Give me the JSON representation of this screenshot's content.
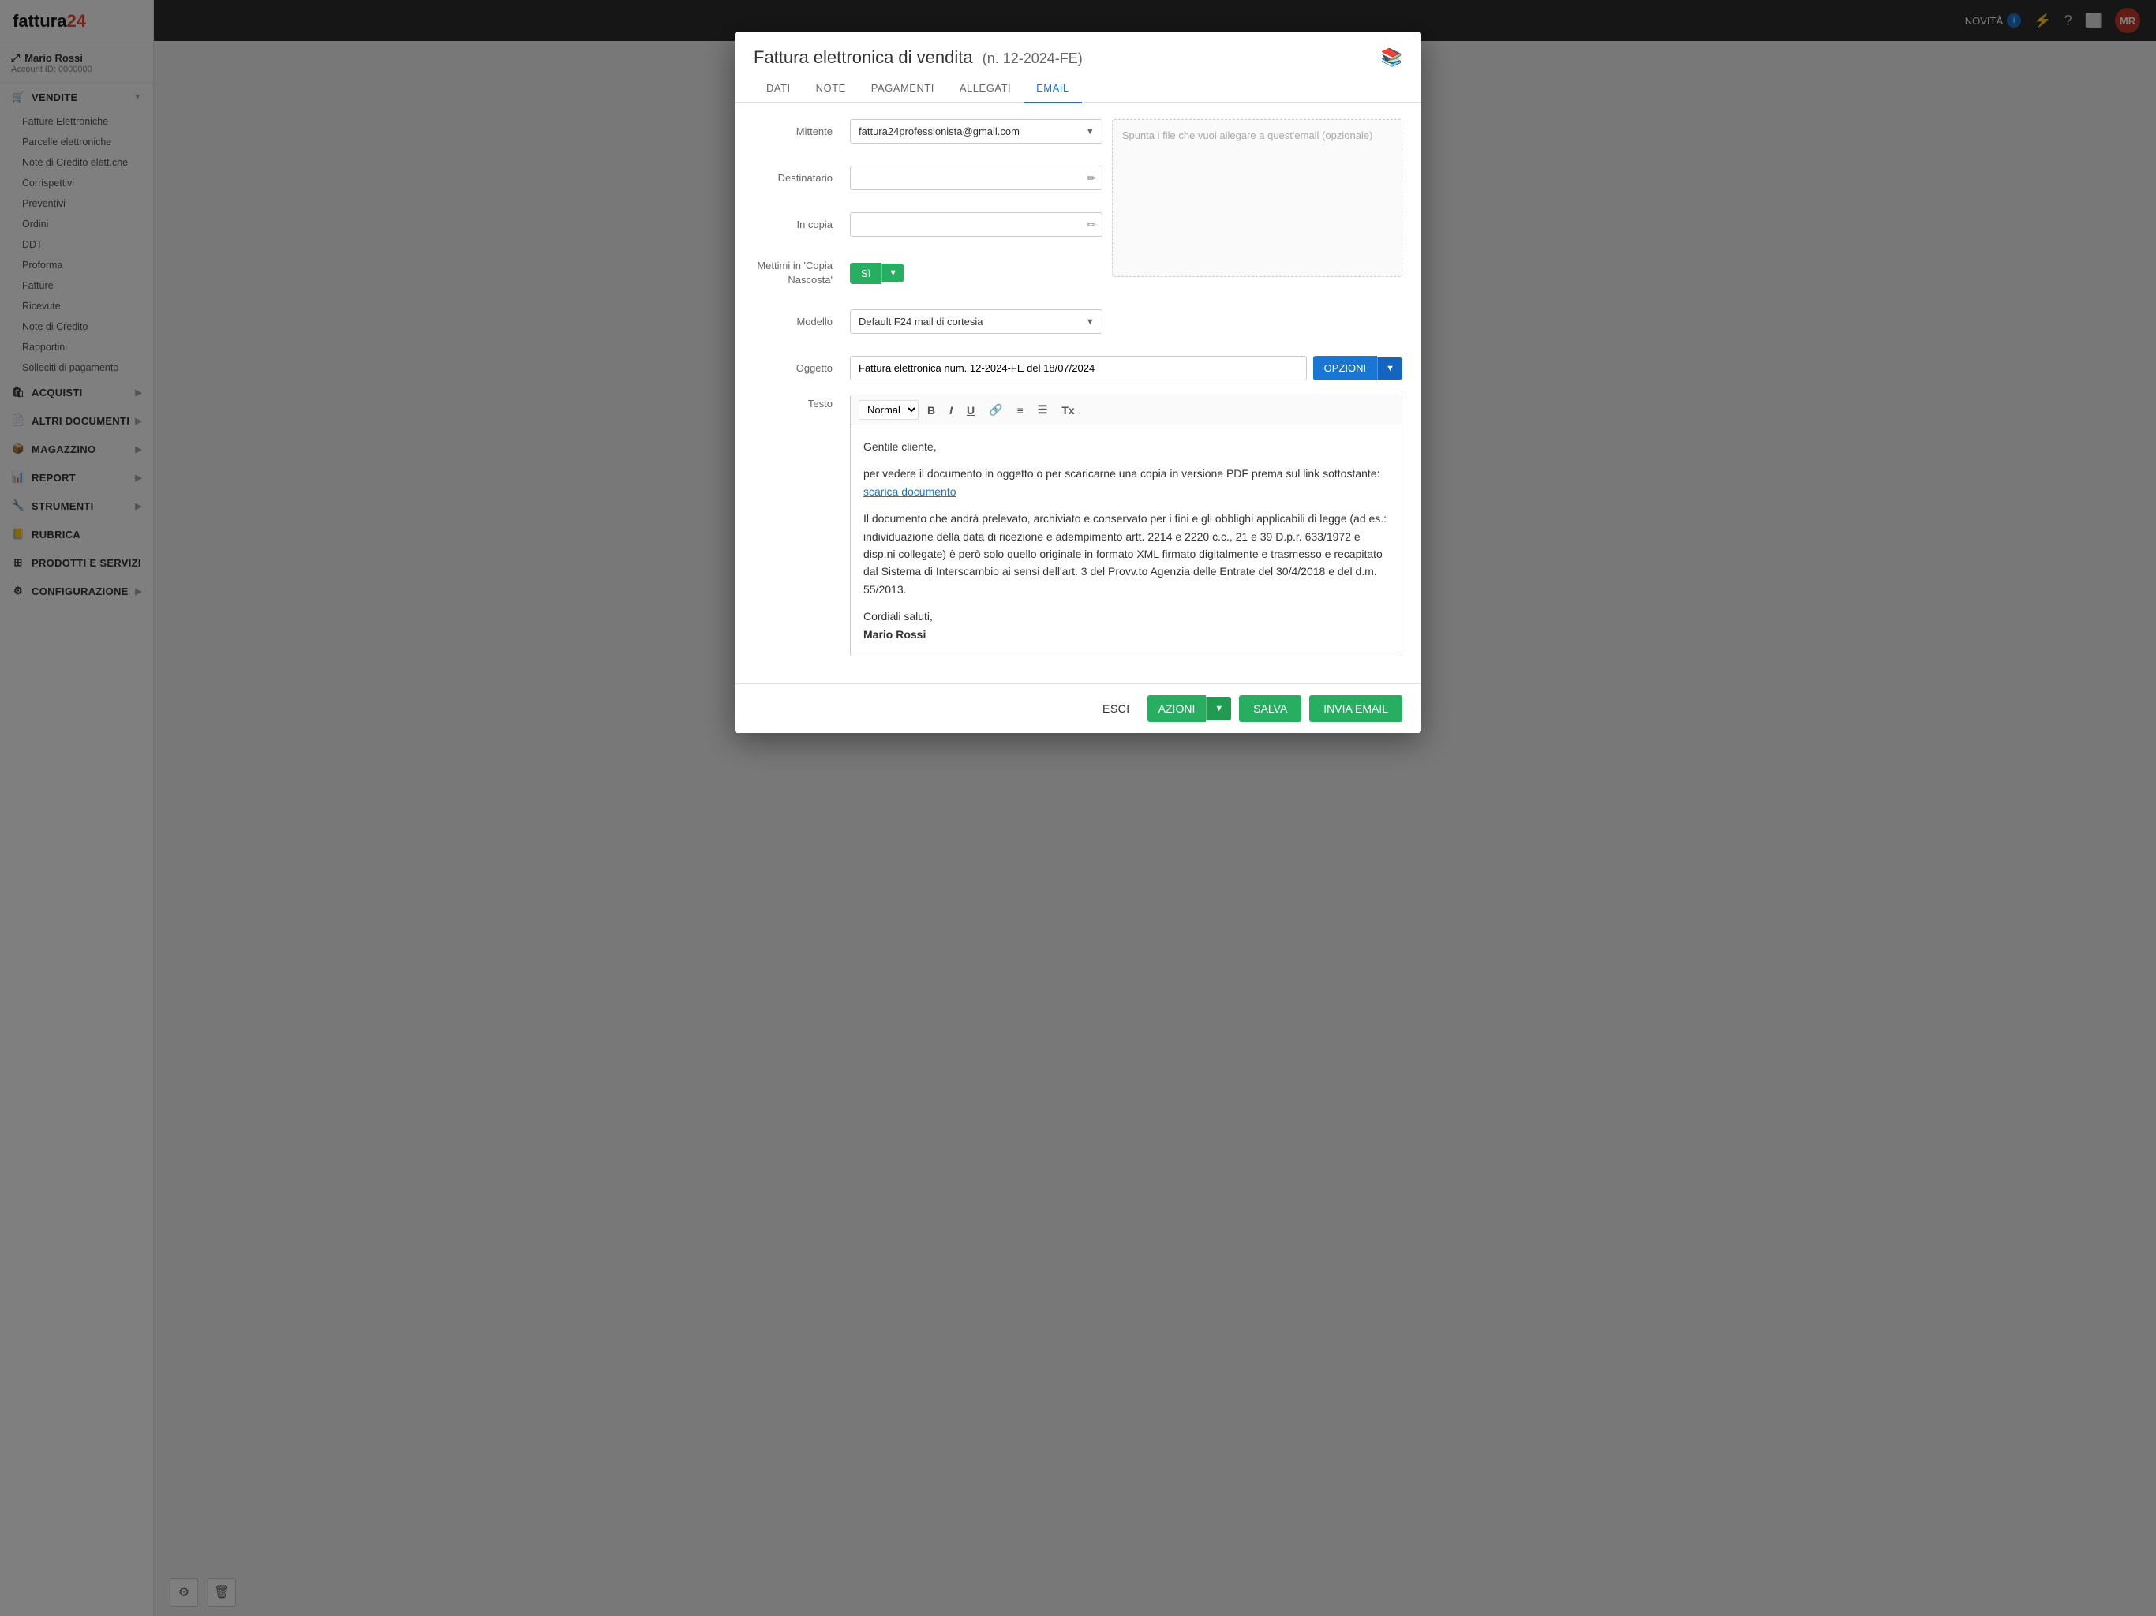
{
  "app": {
    "logo_text": "fattura24",
    "logo_suffix": ""
  },
  "user": {
    "name": "Mario Rossi",
    "account_id": "Account ID: 0000000",
    "initials": "MR"
  },
  "topbar": {
    "novita_label": "NOVITÀ",
    "novita_badge": "i"
  },
  "sidebar": {
    "sections": [
      {
        "id": "vendite",
        "label": "VENDITE",
        "icon": "cart-icon",
        "expanded": true,
        "sub_items": [
          "Fatture Elettroniche",
          "Parcelle elettroniche",
          "Note di Credito elett.che",
          "Corrispettivi",
          "Preventivi",
          "Ordini",
          "DDT",
          "Proforma",
          "Fatture",
          "Ricevute",
          "Note di Credito",
          "Rapportini",
          "Solleciti di pagamento"
        ]
      },
      {
        "id": "acquisti",
        "label": "ACQUISTI",
        "icon": "bag-icon"
      },
      {
        "id": "altri-documenti",
        "label": "ALTRI DOCUMENTI",
        "icon": "file-icon"
      },
      {
        "id": "magazzino",
        "label": "MAGAZZINO",
        "icon": "box-icon"
      },
      {
        "id": "report",
        "label": "REPORT",
        "icon": "chart-icon"
      },
      {
        "id": "strumenti",
        "label": "STRUMENTI",
        "icon": "tools-icon"
      },
      {
        "id": "rubrica",
        "label": "RUBRICA",
        "icon": "book-icon"
      },
      {
        "id": "prodotti-servizi",
        "label": "PRODOTTI E SERVIZI",
        "icon": "grid-icon"
      },
      {
        "id": "configurazione",
        "label": "CONFIGURAZIONE",
        "icon": "gear-icon"
      }
    ]
  },
  "modal": {
    "title": "Fattura elettronica di vendita",
    "subtitle": "(n. 12-2024-FE)",
    "tabs": [
      {
        "id": "dati",
        "label": "DATI"
      },
      {
        "id": "note",
        "label": "NOTE"
      },
      {
        "id": "pagamenti",
        "label": "PAGAMENTI"
      },
      {
        "id": "allegati",
        "label": "ALLEGATI"
      },
      {
        "id": "email",
        "label": "EMAIL",
        "active": true
      }
    ],
    "email": {
      "mittente_label": "Mittente",
      "mittente_value": "fattura24professionista@gmail.com",
      "destinatario_label": "Destinatario",
      "destinatario_placeholder": "",
      "in_copia_label": "In copia",
      "in_copia_placeholder": "",
      "bcc_label": "Mettimi in 'Copia Nascosta'",
      "bcc_value": "Sì",
      "modello_label": "Modello",
      "modello_value": "Default F24 mail di cortesia",
      "file_drop_placeholder": "Spunta i file che vuoi allegare a quest'email (opzionale)",
      "oggetto_label": "Oggetto",
      "oggetto_value": "Fattura elettronica num. 12-2024-FE del 18/07/2024",
      "opzioni_label": "OPZIONI",
      "testo_label": "Testo",
      "toolbar_normal": "Normal",
      "editor_content": {
        "greeting": "Gentile cliente,",
        "line1": "per vedere il documento in oggetto o per scaricarne una copia in versione PDF prema sul link sottostante:",
        "link": "scarica documento",
        "paragraph2": "Il documento che andrà prelevato, archiviato e conservato per i fini e gli obblighi applicabili di legge (ad es.: individuazione della data di ricezione e adempimento artt. 2214 e 2220 c.c., 21 e 39 D.p.r. 633/1972 e disp.ni collegate) è però solo quello originale in formato XML firmato digitalmente e trasmesso e recapitato dal Sistema di Interscambio ai sensi dell'art. 3 del Provv.to Agenzia delle Entrate del 30/4/2018 e del d.m. 55/2013.",
        "closing": "Cordiali saluti,",
        "signature": "Mario Rossi"
      },
      "footer": {
        "esci": "ESCI",
        "azioni": "AZIONI",
        "salva": "SALVA",
        "invia": "INVIA EMAIL"
      }
    }
  }
}
